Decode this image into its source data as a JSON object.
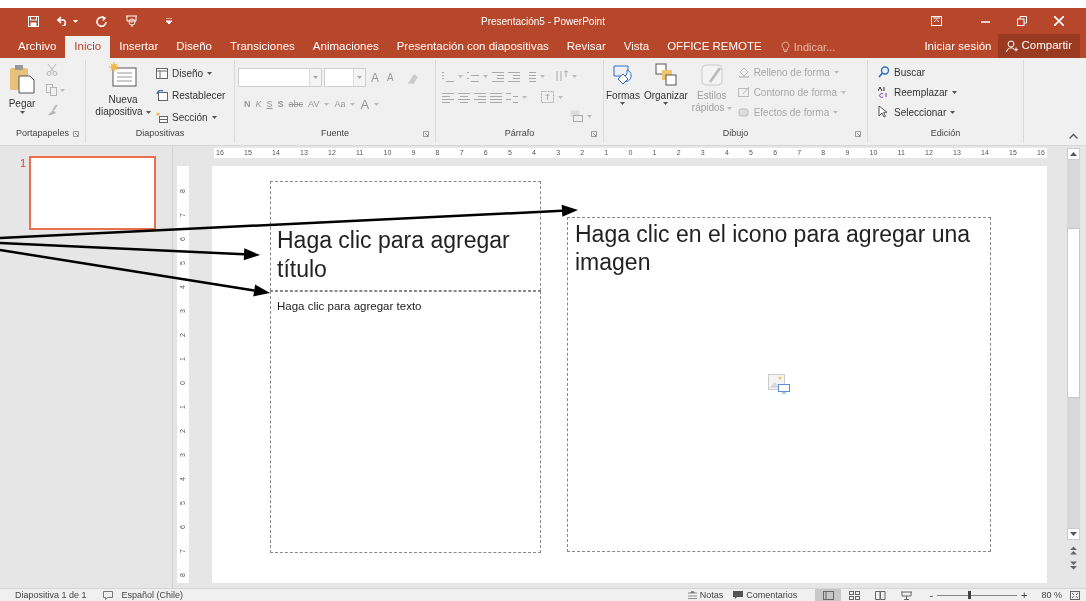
{
  "window": {
    "title": "Presentación5 - PowerPoint"
  },
  "tabs": [
    {
      "label": "Archivo",
      "selected": false
    },
    {
      "label": "Inicio",
      "selected": true
    },
    {
      "label": "Insertar",
      "selected": false
    },
    {
      "label": "Diseño",
      "selected": false
    },
    {
      "label": "Transiciones",
      "selected": false
    },
    {
      "label": "Animaciones",
      "selected": false
    },
    {
      "label": "Presentación con diapositivas",
      "selected": false
    },
    {
      "label": "Revisar",
      "selected": false
    },
    {
      "label": "Vista",
      "selected": false
    },
    {
      "label": "OFFICE REMOTE",
      "selected": false
    }
  ],
  "tell_me": {
    "placeholder": "Indicar..."
  },
  "sign_in": "Iniciar sesión",
  "share": "Compartir",
  "ribbon": {
    "clipboard": {
      "paste": "Pegar",
      "label": "Portapapeles"
    },
    "slides": {
      "new_slide": [
        "Nueva",
        "diapositiva"
      ],
      "layout": "Diseño",
      "reset": "Restablecer",
      "section": "Sección",
      "label": "Diapositivas"
    },
    "font": {
      "size_buttons": [
        {
          "label": "A",
          "disabled": true
        },
        {
          "label": "A",
          "disabled": true
        }
      ],
      "format_buttons": [
        {
          "label": "N",
          "disabled": true
        },
        {
          "label": "K",
          "disabled": true
        },
        {
          "label": "S",
          "disabled": true
        },
        {
          "label": "S",
          "disabled": true
        },
        {
          "label": "abc",
          "disabled": true
        },
        {
          "label": "AV",
          "disabled": true
        },
        {
          "label": "Aa",
          "disabled": true
        },
        {
          "label": "A",
          "disabled": true
        }
      ],
      "label": "Fuente"
    },
    "paragraph": {
      "label": "Párrafo"
    },
    "drawing": {
      "large": [
        {
          "label": [
            "Formas"
          ],
          "disabled": false
        },
        {
          "label": [
            "Organizar"
          ],
          "disabled": false
        },
        {
          "label": [
            "Estilos",
            "rápidos"
          ],
          "disabled": true
        }
      ],
      "small": [
        {
          "label": "Relleno de forma",
          "disabled": true
        },
        {
          "label": "Contorno de forma",
          "disabled": true
        },
        {
          "label": "Efectos de forma",
          "disabled": true
        }
      ],
      "label": "Dibujo"
    },
    "editing": {
      "items": [
        "Buscar",
        "Reemplazar",
        "Seleccionar"
      ],
      "label": "Edición"
    }
  },
  "thumbnails": [
    {
      "number": "1",
      "selected": true
    }
  ],
  "ruler_h": [
    "16",
    "15",
    "14",
    "13",
    "12",
    "11",
    "10",
    "9",
    "8",
    "7",
    "6",
    "5",
    "4",
    "3",
    "2",
    "1",
    "0",
    "1",
    "2",
    "3",
    "4",
    "5",
    "6",
    "7",
    "8",
    "9",
    "10",
    "11",
    "12",
    "13",
    "14",
    "15",
    "16"
  ],
  "ruler_v": [
    "8",
    "7",
    "6",
    "5",
    "4",
    "3",
    "2",
    "1",
    "0",
    "1",
    "2",
    "3",
    "4",
    "5",
    "6",
    "7",
    "8"
  ],
  "slide": {
    "title": "Haga clic para agregar título",
    "body": "Haga clic para agregar texto",
    "picture": "Haga clic en el icono para agregar una imagen"
  },
  "status_bar": {
    "slide": "Diapositiva 1 de 1",
    "language": "Español (Chile)",
    "notes": "Notas",
    "comments": "Comentarios",
    "views": [
      {
        "kind": "normal",
        "selected": true
      },
      {
        "kind": "sorter",
        "selected": false
      },
      {
        "kind": "reading",
        "selected": false
      },
      {
        "kind": "presenter",
        "selected": false
      }
    ],
    "zoom": {
      "out": "-",
      "in": "+",
      "level": 0.4,
      "reading": "80 %"
    }
  }
}
